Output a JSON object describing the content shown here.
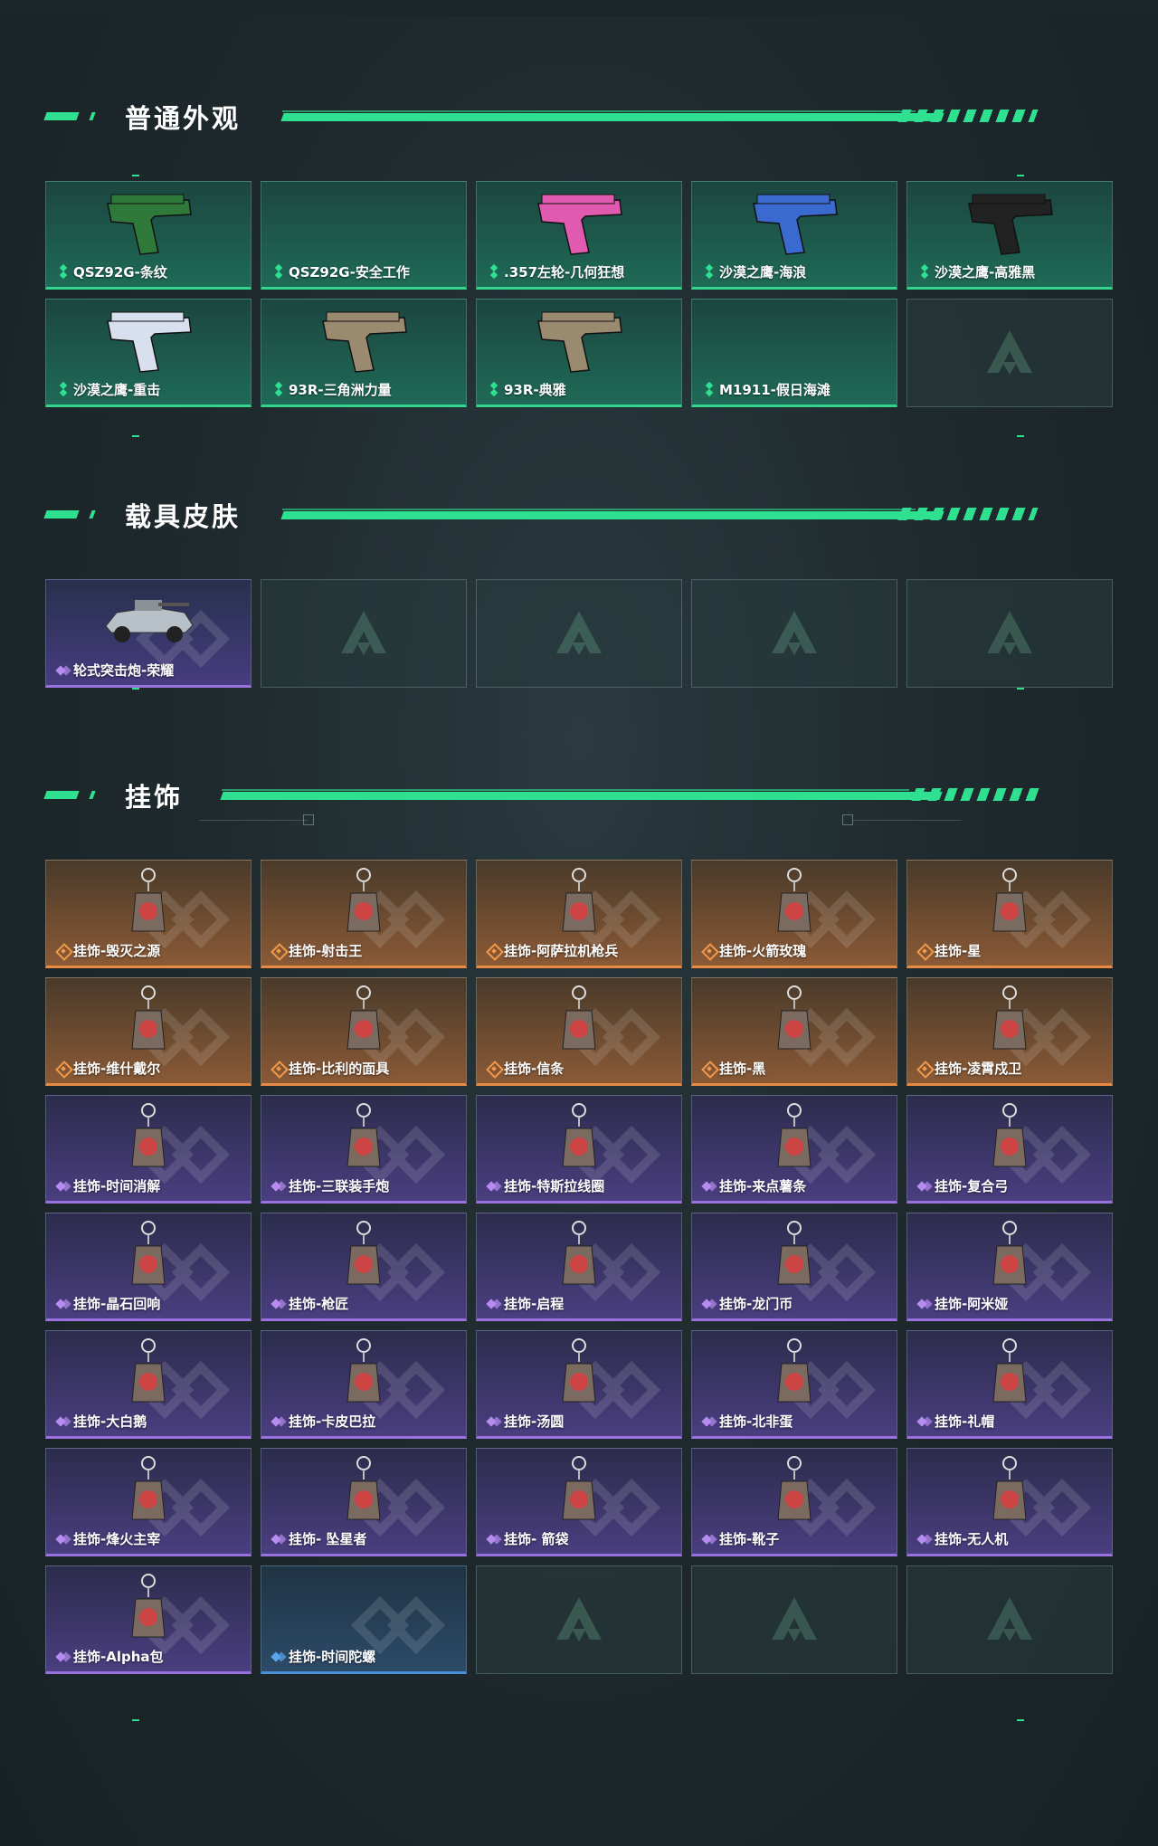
{
  "sections": {
    "weapon_skins": {
      "title": "普通外观",
      "items": [
        {
          "label": "QSZ92G-条纹",
          "rarity": "green",
          "icon": "pistol-green-icon"
        },
        {
          "label": "QSZ92G-安全工作",
          "rarity": "green",
          "icon": ""
        },
        {
          "label": ".357左轮-几何狂想",
          "rarity": "green",
          "icon": "revolver-pink-icon"
        },
        {
          "label": "沙漠之鹰-海浪",
          "rarity": "green",
          "icon": "desert-eagle-blue-icon"
        },
        {
          "label": "沙漠之鹰-高雅黑",
          "rarity": "green",
          "icon": "desert-eagle-black-icon"
        },
        {
          "label": "沙漠之鹰-重击",
          "rarity": "green",
          "icon": "desert-eagle-white-icon"
        },
        {
          "label": "93R-三角洲力量",
          "rarity": "green",
          "icon": "pistol-tan-icon"
        },
        {
          "label": "93R-典雅",
          "rarity": "green",
          "icon": "pistol-tan-icon"
        },
        {
          "label": "M1911-假日海滩",
          "rarity": "green",
          "icon": ""
        },
        {
          "label": "",
          "rarity": "empty",
          "icon": "logo-watermark-icon"
        }
      ]
    },
    "vehicle_skins": {
      "title": "载具皮肤",
      "items": [
        {
          "label": "轮式突击炮-荣耀",
          "rarity": "vpurple",
          "icon": "armored-vehicle-icon"
        },
        {
          "label": "",
          "rarity": "empty",
          "icon": "logo-watermark-icon"
        },
        {
          "label": "",
          "rarity": "empty",
          "icon": "logo-watermark-icon"
        },
        {
          "label": "",
          "rarity": "empty",
          "icon": "logo-watermark-icon"
        },
        {
          "label": "",
          "rarity": "empty",
          "icon": "logo-watermark-icon"
        }
      ]
    },
    "charms": {
      "title": "挂饰",
      "items": [
        {
          "label": "挂饰-毁灭之源",
          "rarity": "orange",
          "icon": "dragon-charm-icon"
        },
        {
          "label": "挂饰-射击王",
          "rarity": "orange",
          "icon": "soldier-charm-icon"
        },
        {
          "label": "挂饰-阿萨拉机枪兵",
          "rarity": "orange",
          "icon": "gunner-charm-icon"
        },
        {
          "label": "挂饰-火箭玫瑰",
          "rarity": "orange",
          "icon": "rocket-charm-icon"
        },
        {
          "label": "挂饰-星",
          "rarity": "orange",
          "icon": "card-charm-icon"
        },
        {
          "label": "挂饰-维什戴尔",
          "rarity": "orange",
          "icon": "tag-charm-icon"
        },
        {
          "label": "挂饰-比利的面具",
          "rarity": "orange",
          "icon": "mask-charm-icon"
        },
        {
          "label": "挂饰-信条",
          "rarity": "orange",
          "icon": "figure-charm-icon"
        },
        {
          "label": "挂饰-黑",
          "rarity": "orange",
          "icon": "tag-charm-icon"
        },
        {
          "label": "挂饰-凌霄戍卫",
          "rarity": "orange",
          "icon": "bird-charm-icon"
        },
        {
          "label": "挂饰-时间消解",
          "rarity": "purple",
          "icon": "keychain-charm-icon"
        },
        {
          "label": "挂饰-三联装手炮",
          "rarity": "purple",
          "icon": "cannon-charm-icon"
        },
        {
          "label": "挂饰-特斯拉线圈",
          "rarity": "purple",
          "icon": "coil-charm-icon"
        },
        {
          "label": "挂饰-来点薯条",
          "rarity": "purple",
          "icon": "fries-charm-icon"
        },
        {
          "label": "挂饰-复合弓",
          "rarity": "purple",
          "icon": "bow-charm-icon"
        },
        {
          "label": "挂饰-晶石回响",
          "rarity": "purple",
          "icon": "crystal-charm-icon"
        },
        {
          "label": "挂饰-枪匠",
          "rarity": "purple",
          "icon": "box-charm-icon"
        },
        {
          "label": "挂饰-启程",
          "rarity": "purple",
          "icon": "badge-charm-icon"
        },
        {
          "label": "挂饰-龙门币",
          "rarity": "purple",
          "icon": "coin-charm-icon"
        },
        {
          "label": "挂饰-阿米娅",
          "rarity": "purple",
          "icon": "rabbit-charm-icon"
        },
        {
          "label": "挂饰-大白鹅",
          "rarity": "purple",
          "icon": "goose-charm-icon"
        },
        {
          "label": "挂饰-卡皮巴拉",
          "rarity": "purple",
          "icon": "capybara-charm-icon"
        },
        {
          "label": "挂饰-汤圆",
          "rarity": "purple",
          "icon": "bowl-charm-icon"
        },
        {
          "label": "挂饰-北非蛋",
          "rarity": "purple",
          "icon": "pan-charm-icon"
        },
        {
          "label": "挂饰-礼帽",
          "rarity": "purple",
          "icon": "hat-charm-icon"
        },
        {
          "label": "挂饰-烽火主宰",
          "rarity": "purple",
          "icon": "triangle-charm-icon"
        },
        {
          "label": "挂饰- 坠星者",
          "rarity": "purple",
          "icon": "triangle-charm-icon"
        },
        {
          "label": "挂饰- 箭袋",
          "rarity": "purple",
          "icon": "quiver-charm-icon"
        },
        {
          "label": "挂饰-靴子",
          "rarity": "purple",
          "icon": "boot-charm-icon"
        },
        {
          "label": "挂饰-无人机",
          "rarity": "purple",
          "icon": "drone-charm-icon"
        },
        {
          "label": "挂饰-Alpha包",
          "rarity": "purple",
          "icon": "bag-charm-icon"
        },
        {
          "label": "挂饰-时间陀螺",
          "rarity": "blue",
          "icon": ""
        },
        {
          "label": "",
          "rarity": "empty",
          "icon": "logo-watermark-icon"
        },
        {
          "label": "",
          "rarity": "empty",
          "icon": "logo-watermark-icon"
        },
        {
          "label": "",
          "rarity": "empty",
          "icon": "logo-watermark-icon"
        }
      ]
    }
  },
  "colors": {
    "accent": "#2ee08f",
    "green": "#33d48c",
    "orange": "#e68a45",
    "purple": "#9a72e0",
    "blue": "#4a90d8"
  }
}
